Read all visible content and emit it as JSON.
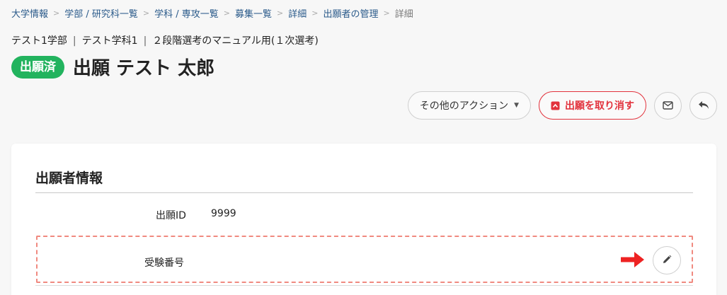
{
  "breadcrumb": {
    "items": [
      {
        "label": "大学情報"
      },
      {
        "label": "学部 / 研究科一覧"
      },
      {
        "label": "学科 / 専攻一覧"
      },
      {
        "label": "募集一覧"
      },
      {
        "label": "詳細"
      },
      {
        "label": "出願者の管理"
      },
      {
        "label": "詳細"
      }
    ],
    "separator": ">"
  },
  "header": {
    "faculty": "テスト1学部",
    "department": "テスト学科1",
    "recruitment": "２段階選考のマニュアル用(１次選考)",
    "separator": "|",
    "status_badge": "出願済",
    "title": "出願 テスト 太郎"
  },
  "actions": {
    "other_actions_label": "その他のアクション",
    "cancel_application_label": "出願を取り消す"
  },
  "applicant_info": {
    "section_title": "出願者情報",
    "application_id_label": "出願ID",
    "application_id_value": "9999",
    "exam_number_label": "受験番号",
    "exam_number_value": ""
  },
  "colors": {
    "badge_green": "#22b35e",
    "danger_red": "#e2333d",
    "link_blue": "#2a5a8a",
    "highlight_dashed": "#f08a80",
    "pointer_arrow": "#ee2222"
  },
  "icons": {
    "other_actions_caret": "caret-down-icon",
    "cancel_application": "cancel-box-icon",
    "mail": "envelope-icon",
    "back": "reply-icon",
    "edit": "pencil-icon",
    "pointer": "arrow-right-icon"
  }
}
